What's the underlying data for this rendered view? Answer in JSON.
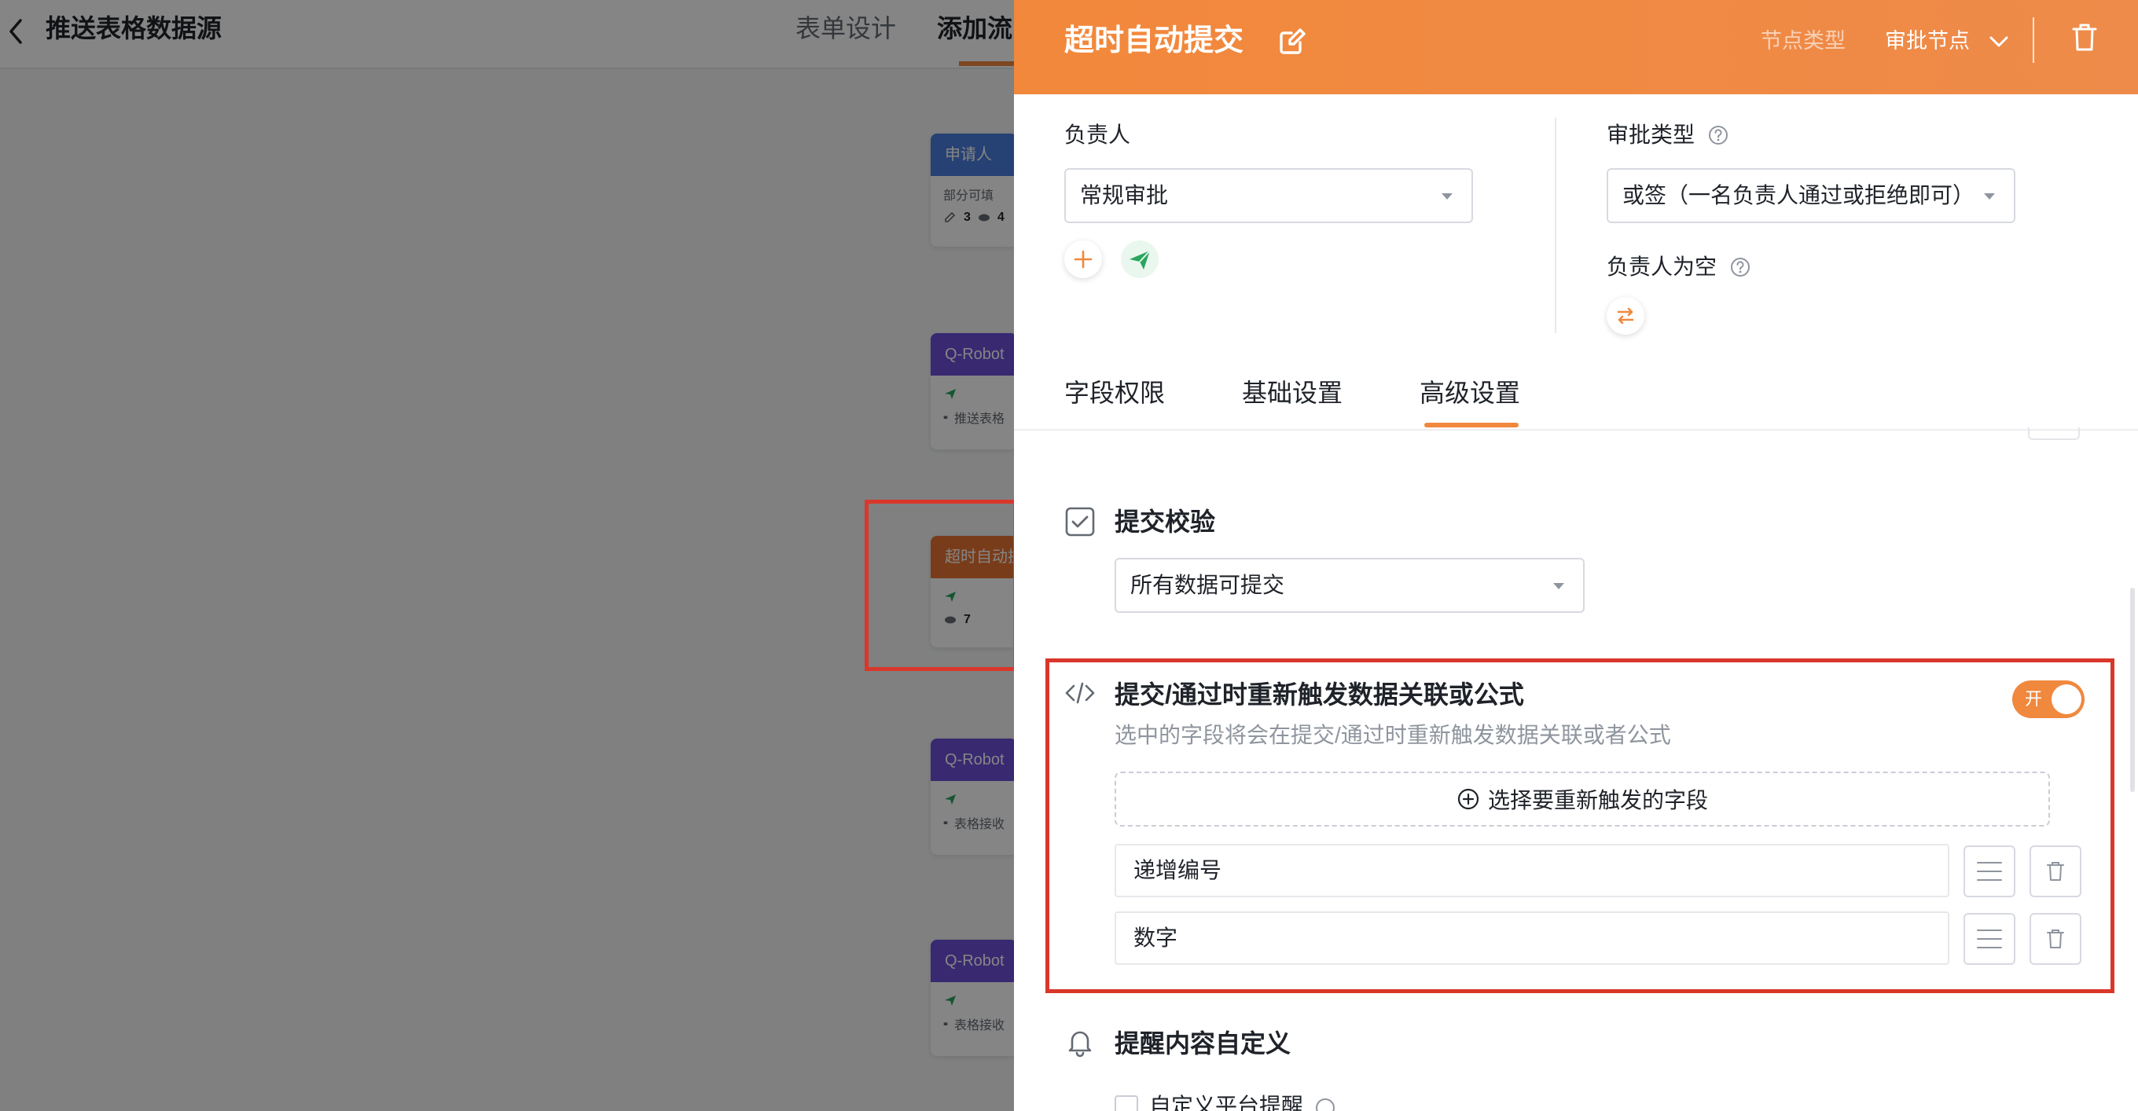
{
  "background": {
    "page_title": "推送表格数据源",
    "tabs": [
      {
        "label": "表单设计"
      },
      {
        "label": "添加流"
      }
    ],
    "nodes": [
      {
        "title": "申请人",
        "subtitle": "部分可填",
        "edit_count": "3",
        "view_count": "4",
        "color": "#4a7ddc"
      },
      {
        "title": "Q-Robot",
        "detail": "推送表格",
        "color": "#6b4fd8"
      },
      {
        "title": "超时自动提",
        "view_count": "7",
        "color": "#e97433"
      },
      {
        "title": "Q-Robot",
        "detail": "表格接收",
        "color": "#6b4fd8"
      },
      {
        "title": "Q-Robot",
        "detail": "表格接收",
        "color": "#6b4fd8"
      }
    ]
  },
  "drawer": {
    "title": "超时自动提交",
    "node_type_label": "节点类型",
    "node_type_value": "审批节点",
    "header_color": "#f0883e",
    "assignee": {
      "label": "负责人",
      "select_value": "常规审批"
    },
    "approval_type": {
      "label": "审批类型",
      "select_value": "或签（一名负责人通过或拒绝即可）"
    },
    "empty_assignee": {
      "label": "负责人为空"
    },
    "tabs": [
      {
        "label": "字段权限",
        "active": false
      },
      {
        "label": "基础设置",
        "active": false
      },
      {
        "label": "高级设置",
        "active": true
      }
    ],
    "submit_validation": {
      "title": "提交校验",
      "select_value": "所有数据可提交"
    },
    "retrigger": {
      "title": "提交/通过时重新触发数据关联或公式",
      "description": "选中的字段将会在提交/通过时重新触发数据关联或者公式",
      "toggle_label": "开",
      "toggle_on": true,
      "add_button_label": "选择要重新触发的字段",
      "fields": [
        {
          "name": "递增编号"
        },
        {
          "name": "数字"
        }
      ]
    },
    "reminder": {
      "title": "提醒内容自定义",
      "platform_reminder_label": "自定义平台提醒"
    }
  },
  "accent_color": "#f0883e",
  "highlight_color": "#d9372a"
}
